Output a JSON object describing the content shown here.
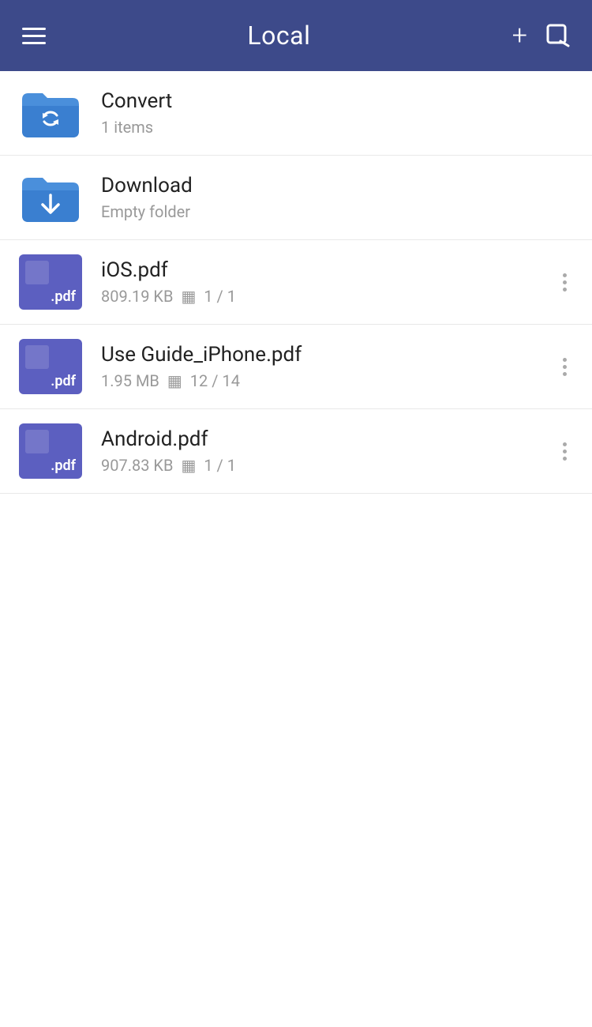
{
  "header": {
    "title": "Local",
    "add_label": "+",
    "hamburger_label": "menu",
    "edit_label": "edit"
  },
  "items": [
    {
      "id": "convert",
      "type": "folder",
      "folder_variant": "convert",
      "name": "Convert",
      "meta": "1 items",
      "show_more": false
    },
    {
      "id": "download",
      "type": "folder",
      "folder_variant": "download",
      "name": "Download",
      "meta": "Empty folder",
      "show_more": false
    },
    {
      "id": "ios-pdf",
      "type": "pdf",
      "name": "iOS.pdf",
      "size": "809.19 KB",
      "pages": "1 / 1",
      "show_more": true
    },
    {
      "id": "use-guide",
      "type": "pdf",
      "name": "Use Guide_iPhone.pdf",
      "size": "1.95 MB",
      "pages": "12 / 14",
      "show_more": true
    },
    {
      "id": "android-pdf",
      "type": "pdf",
      "name": "Android.pdf",
      "size": "907.83 KB",
      "pages": "1 / 1",
      "show_more": true
    }
  ],
  "colors": {
    "header_bg": "#3d4a8a",
    "folder_blue": "#4a90d9",
    "folder_dark_blue": "#1a6bbf",
    "pdf_bg": "#5c5fc0"
  }
}
